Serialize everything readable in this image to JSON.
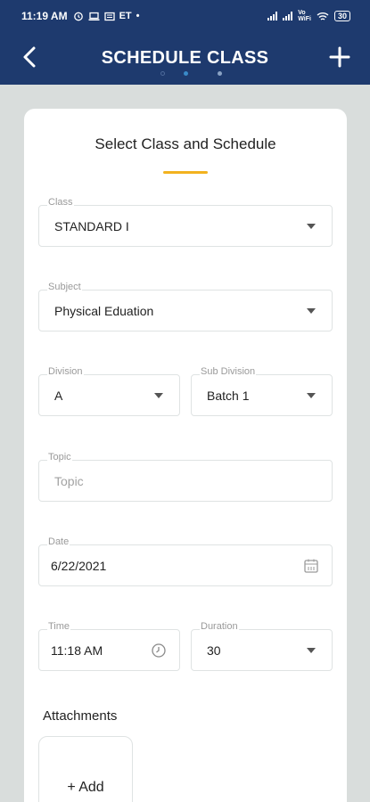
{
  "status_bar": {
    "time": "11:19 AM",
    "carrier": "ET",
    "network": "Vo\nWiFi",
    "battery": "30"
  },
  "header": {
    "title": "SCHEDULE CLASS",
    "back_icon": "chevron-left-icon",
    "add_icon": "plus-icon"
  },
  "colors": {
    "header_bg": "#1e3a6e",
    "accent": "#f2b21f",
    "background": "#d9dddc"
  },
  "form": {
    "heading": "Select Class and Schedule",
    "class": {
      "label": "Class",
      "value": "STANDARD I"
    },
    "subject": {
      "label": "Subject",
      "value": "Physical Eduation"
    },
    "division": {
      "label": "Division",
      "value": "A"
    },
    "sub_division": {
      "label": "Sub Division",
      "value": "Batch 1"
    },
    "topic": {
      "label": "Topic",
      "placeholder": "Topic"
    },
    "date": {
      "label": "Date",
      "value": "6/22/2021"
    },
    "time": {
      "label": "Time",
      "value": "11:18 AM"
    },
    "duration": {
      "label": "Duration",
      "value": "30"
    }
  },
  "attachments": {
    "label": "Attachments",
    "add_label": "+ Add"
  }
}
